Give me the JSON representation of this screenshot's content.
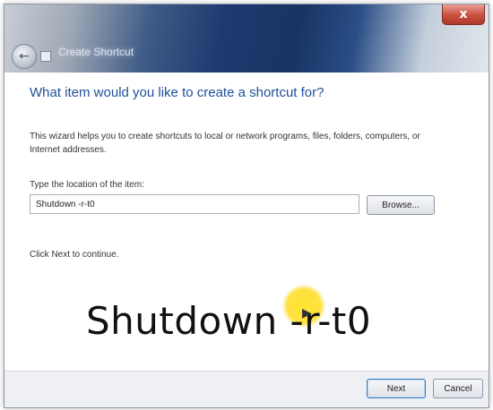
{
  "window": {
    "title": "Create Shortcut",
    "close_glyph": "x",
    "back_icon": "back-arrow-icon"
  },
  "wizard": {
    "heading": "What item would you like to create a shortcut for?",
    "description": "This wizard helps you to create shortcuts to local or network programs, files, folders, computers, or Internet addresses.",
    "location_label": "Type the location of the item:",
    "location_value": "Shutdown -r-t0",
    "browse_label": "Browse...",
    "continue_text": "Click Next to continue."
  },
  "footer": {
    "next_label": "Next",
    "cancel_label": "Cancel"
  },
  "overlay": {
    "caption": "Shutdown -r-t0",
    "highlight_color": "#ffe128"
  }
}
